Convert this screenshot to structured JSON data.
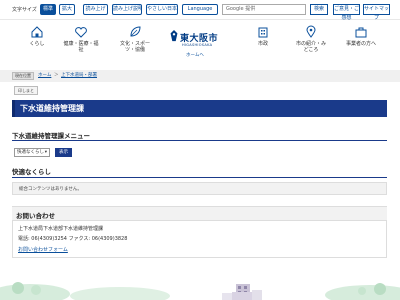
{
  "utility": {
    "font_size_label": "文字サイズ",
    "font_standard": "標準",
    "font_large": "拡大",
    "read_aloud": "読み上げ",
    "read_aloud_help": "読み上げ説明",
    "easy_japanese": "やさしい日本語",
    "language": "Language",
    "search_placeholder": "Google 提供",
    "search_button": "検索",
    "feedback": "ご意見・ご感想",
    "sitemap": "サイトマップ"
  },
  "nav": {
    "kurashi": "くらし",
    "health": "健康・医療・福祉",
    "culture": "文化・スポーツ・協働",
    "city_gov": "市政",
    "city_info": "市の紹介・みどころ",
    "business": "事業者の方へ"
  },
  "logo": {
    "name": "東大阪市",
    "romaji": "HIGASHIOSAKA",
    "home": "ホームへ"
  },
  "breadcrumb": {
    "tag": "現在位置",
    "home": "ホーム",
    "sep1": "＞",
    "dept": "上下水道局・部署"
  },
  "print_label": "印しまと",
  "page_title": "下水道維持管理課",
  "menu": {
    "heading": "下水道維持管理課メニュー",
    "select_value": "快適なくらし",
    "go_button": "表示"
  },
  "kaiteki": {
    "heading": "快適なくらし",
    "notice": "総合コンテンツはありません。"
  },
  "contact": {
    "heading": "お問い合わせ",
    "line1": "上下水道局下水道部下水道維持管理課",
    "line2": "電話: 06(4309)3254 ファクス: 06(4309)3828",
    "form_link": "お問い合わせフォーム"
  },
  "colors": {
    "accent": "#1a3a8a",
    "link": "#0a4f9b"
  }
}
